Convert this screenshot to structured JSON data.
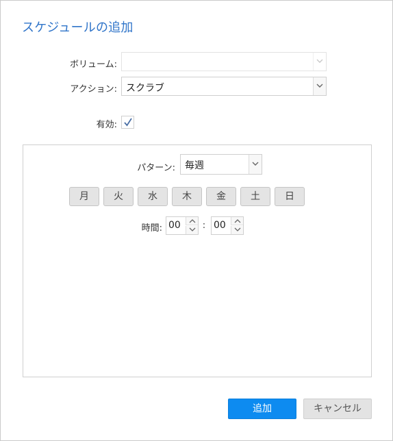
{
  "dialog": {
    "title": "スケジュールの追加"
  },
  "form": {
    "volume_label": "ボリューム:",
    "volume_value": "",
    "action_label": "アクション:",
    "action_value": "スクラブ",
    "enabled_label": "有効:",
    "enabled_checked": true
  },
  "schedule": {
    "pattern_label": "パターン:",
    "pattern_value": "毎週",
    "days": [
      "月",
      "火",
      "水",
      "木",
      "金",
      "土",
      "日"
    ],
    "time_label": "時間:",
    "hour": "00",
    "separator": ":",
    "minute": "00"
  },
  "buttons": {
    "add": "追加",
    "cancel": "キャンセル"
  },
  "colors": {
    "title": "#2f74c9",
    "primary": "#0d8bf0",
    "secondary": "#e3e3e3"
  },
  "icons": {
    "select_arrow": "chevron-down-icon",
    "checkbox": "checkmark-icon",
    "spin_up": "chevron-up-icon",
    "spin_down": "chevron-down-icon"
  }
}
